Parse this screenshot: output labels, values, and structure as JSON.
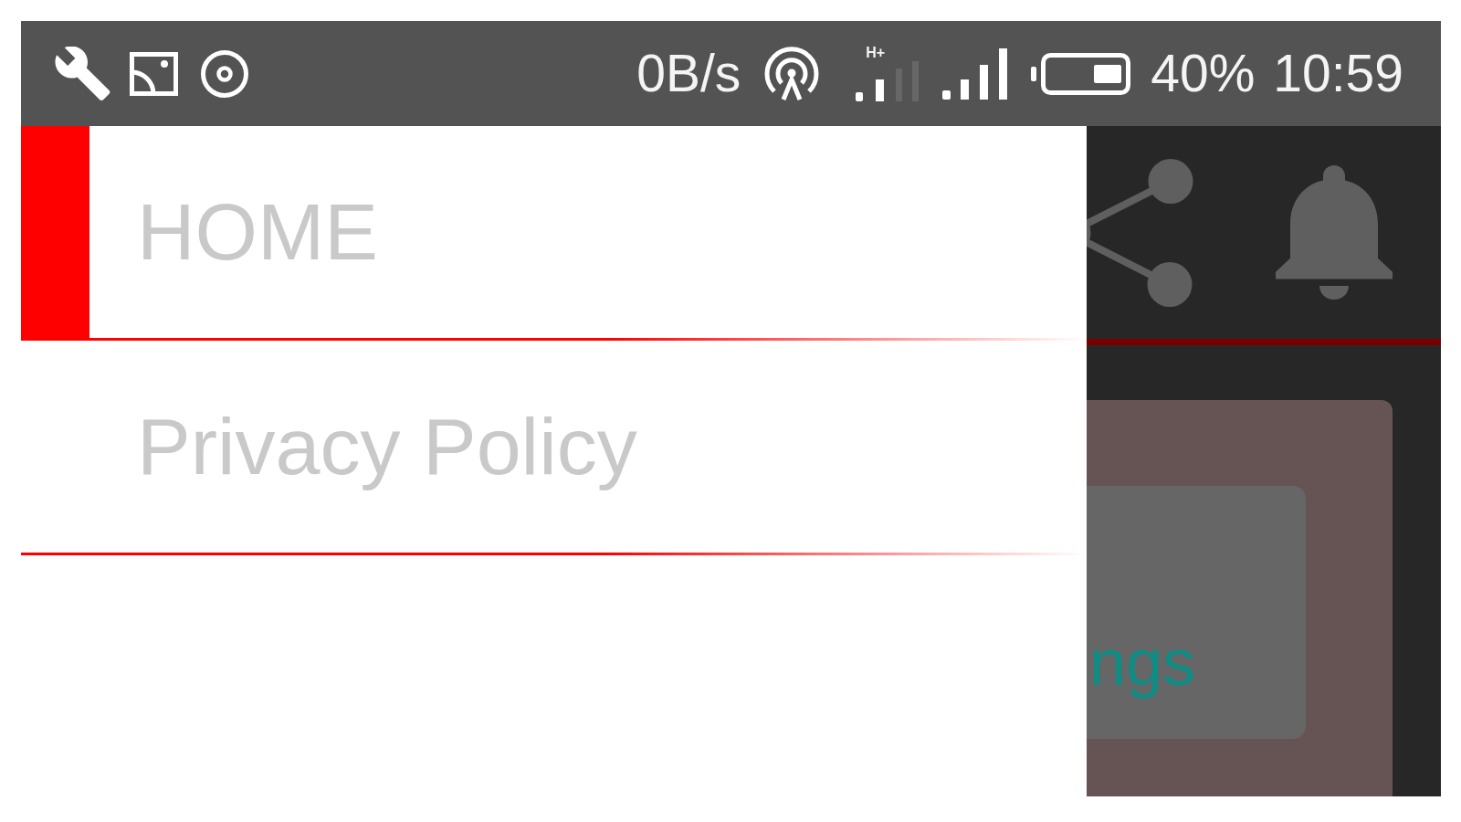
{
  "status_bar": {
    "network_speed": "0B/s",
    "network_type": "H+",
    "battery_percent": "40%",
    "time": "10:59"
  },
  "drawer": {
    "items": [
      {
        "label": "HOME",
        "selected": true
      },
      {
        "label": "Privacy Policy",
        "selected": false
      }
    ]
  },
  "content": {
    "card": {
      "text": "ngs"
    }
  }
}
